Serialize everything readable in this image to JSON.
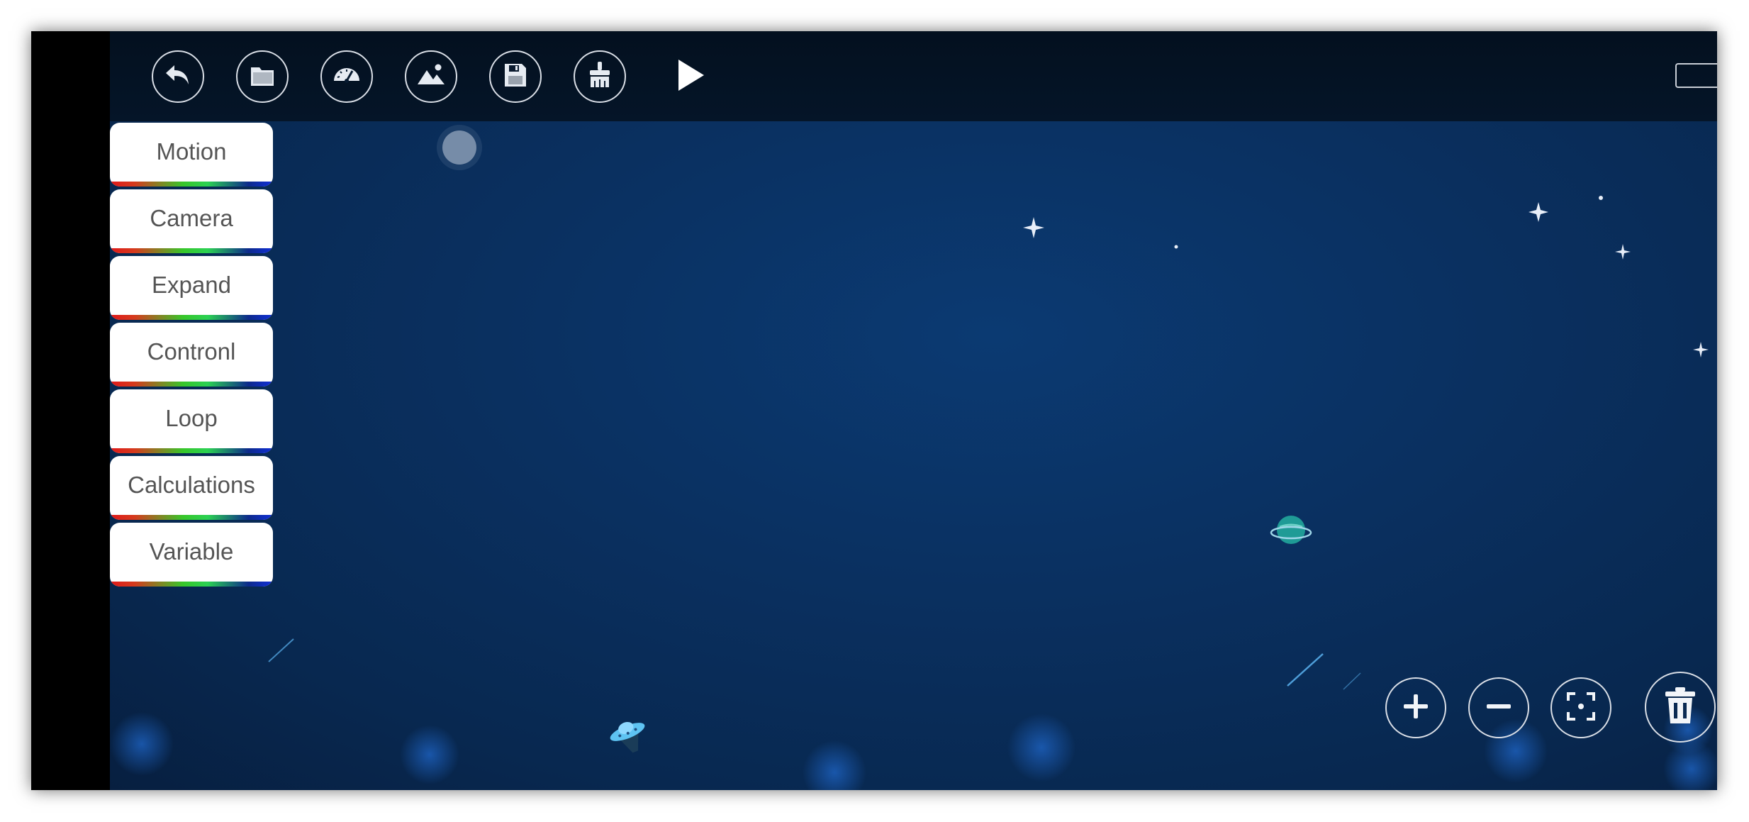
{
  "toolbar": {
    "buttons": [
      {
        "name": "back-button",
        "icon": "undo-arrow-icon"
      },
      {
        "name": "open-folder-button",
        "icon": "folder-icon"
      },
      {
        "name": "speed-button",
        "icon": "speedometer-icon"
      },
      {
        "name": "background-button",
        "icon": "image-mountain-icon"
      },
      {
        "name": "save-button",
        "icon": "floppy-disk-icon"
      },
      {
        "name": "clear-button",
        "icon": "broom-icon"
      }
    ],
    "run_icon": "play-icon",
    "battery_icon": "battery-icon"
  },
  "palette": {
    "categories": [
      {
        "label": "Motion"
      },
      {
        "label": "Camera"
      },
      {
        "label": "Expand"
      },
      {
        "label": "Contronl"
      },
      {
        "label": "Loop"
      },
      {
        "label": "Calculations"
      },
      {
        "label": "Variable"
      }
    ]
  },
  "canvas_controls": {
    "zoom_in_icon": "plus-icon",
    "zoom_out_icon": "minus-icon",
    "center_icon": "focus-center-icon",
    "delete_icon": "trash-icon"
  },
  "colors": {
    "background": "#0a3060",
    "toolbar": "#051528",
    "button_border": "#d9dee6"
  }
}
